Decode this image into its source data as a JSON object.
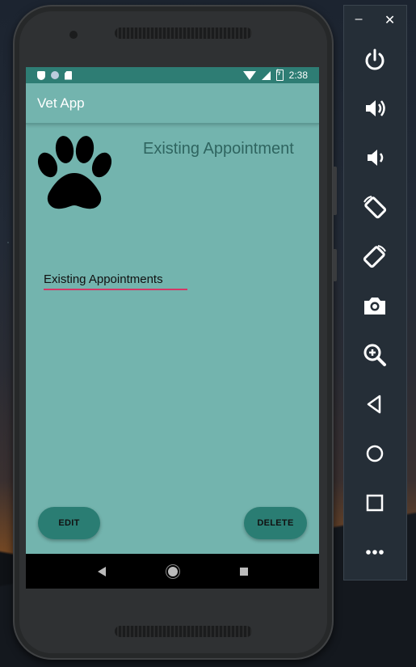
{
  "status_bar": {
    "time": "2:38"
  },
  "app_bar": {
    "title": "Vet App"
  },
  "screen": {
    "heading": "Existing Appointment",
    "field_value": "Existing Appointments",
    "edit_label": "EDIT",
    "delete_label": "DELETE"
  },
  "emulator_toolbar": {
    "minimize_label": "–",
    "close_label": "✕",
    "tools": [
      "power-icon",
      "volume-up-icon",
      "volume-down-icon",
      "rotate-left-icon",
      "rotate-right-icon",
      "camera-icon",
      "zoom-icon",
      "back-icon",
      "home-icon",
      "overview-icon",
      "more-icon"
    ]
  },
  "colors": {
    "screen_bg": "#73b4ae",
    "status_bar": "#2e7d74",
    "button": "#2a7d73",
    "underline": "#d33866",
    "toolbar_bg": "#252e37"
  }
}
